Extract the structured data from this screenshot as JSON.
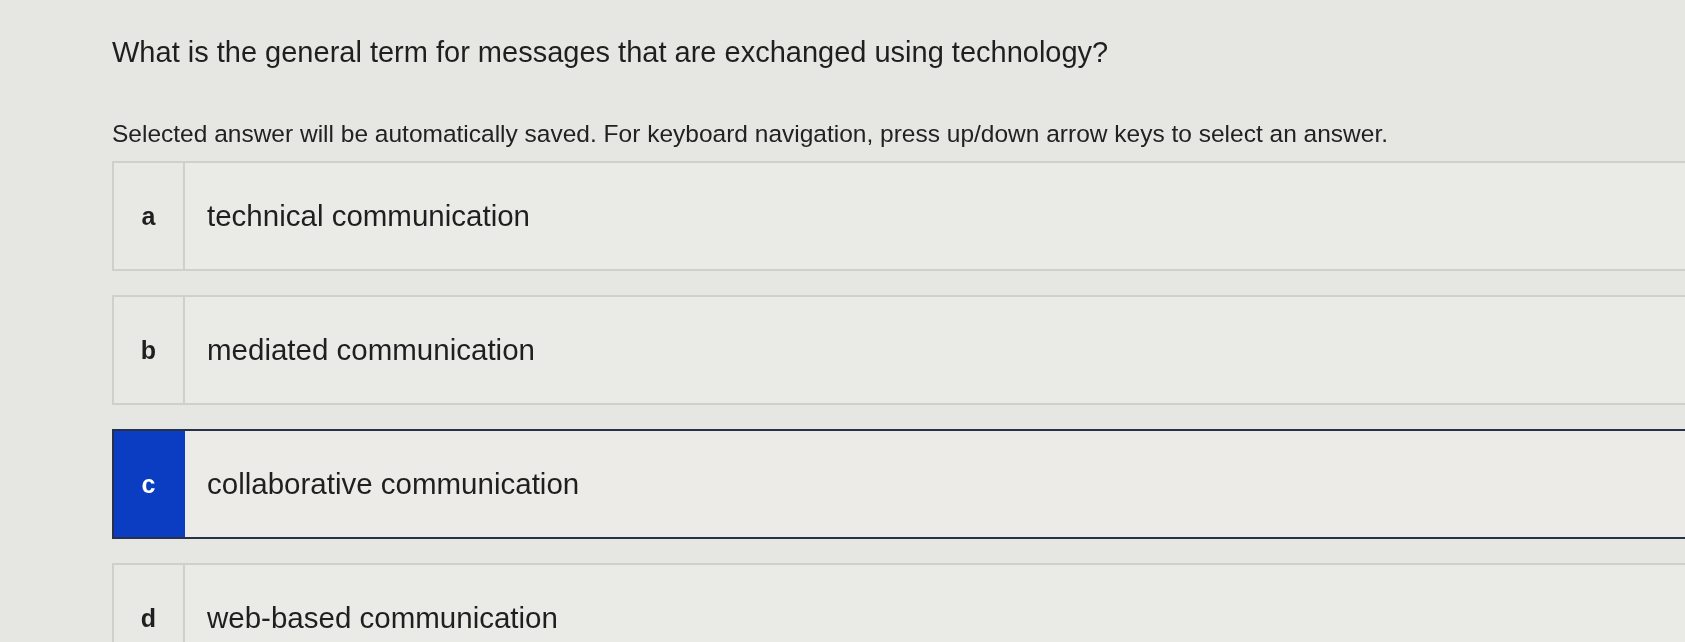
{
  "question": "What is the general term for messages that are exchanged using technology?",
  "instructions": "Selected answer will be automatically saved. For keyboard navigation, press up/down arrow keys to select an answer.",
  "options": [
    {
      "letter": "a",
      "text": "technical communication",
      "selected": false
    },
    {
      "letter": "b",
      "text": "mediated communication",
      "selected": false
    },
    {
      "letter": "c",
      "text": "collaborative communication",
      "selected": true
    },
    {
      "letter": "d",
      "text": "web-based communication",
      "selected": false
    }
  ]
}
